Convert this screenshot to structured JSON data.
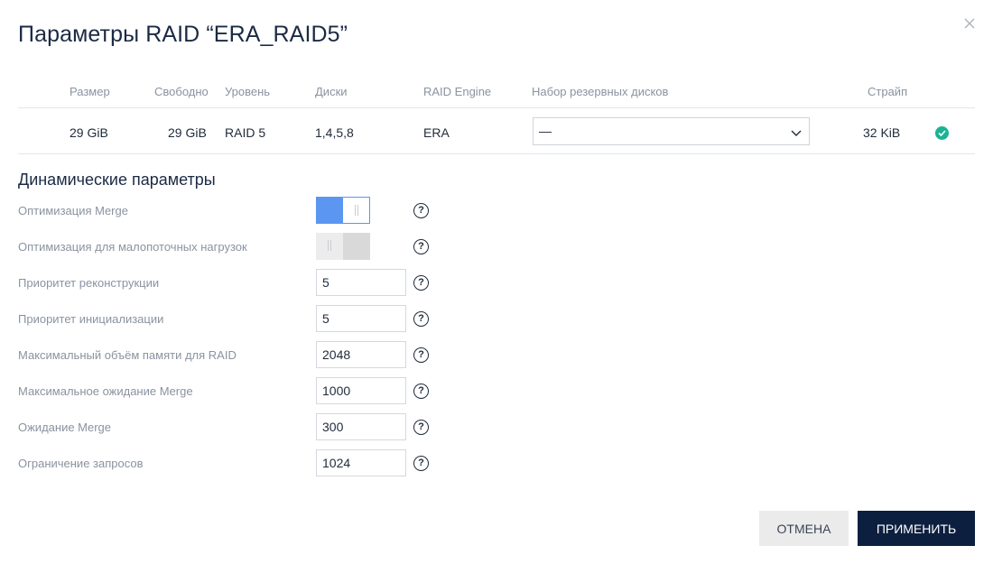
{
  "dialog": {
    "title": "Параметры RAID “ERA_RAID5”"
  },
  "icons": {
    "close": "close-icon",
    "help": "question-circle-icon",
    "status": "check-circle-icon",
    "dropdown": "chevron-down-icon"
  },
  "table": {
    "headers": {
      "size": "Размер",
      "free": "Свободно",
      "level": "Уровень",
      "disks": "Диски",
      "engine": "RAID Engine",
      "spares": "Набор резервных дисков",
      "stripe": "Страйп"
    },
    "row": {
      "size": "29 GiB",
      "free": "29 GiB",
      "level": "RAID 5",
      "disks": "1,4,5,8",
      "engine": "ERA",
      "spares": "—",
      "stripe": "32 KiB"
    }
  },
  "dynamic": {
    "section_title": "Динамические параметры",
    "merge_opt": {
      "label": "Оптимизация Merge",
      "enabled": true
    },
    "low_stream_opt": {
      "label": "Оптимизация для малопоточных нагрузок",
      "enabled": false
    },
    "rebuild_priority": {
      "label": "Приоритет реконструкции",
      "value": "5"
    },
    "init_priority": {
      "label": "Приоритет инициализации",
      "value": "5"
    },
    "max_memory": {
      "label": "Максимальный объём памяти для RAID",
      "value": "2048"
    },
    "max_merge_wait": {
      "label": "Максимальное ожидание Merge",
      "value": "1000"
    },
    "merge_wait": {
      "label": "Ожидание Merge",
      "value": "300"
    },
    "request_limit": {
      "label": "Ограничение запросов",
      "value": "1024"
    }
  },
  "buttons": {
    "cancel": "ОТМЕНА",
    "apply": "ПРИМЕНИТЬ"
  },
  "colors": {
    "accent": "#5b97f0",
    "primary_button": "#0c1f3f",
    "status_ok": "#1bb394"
  }
}
